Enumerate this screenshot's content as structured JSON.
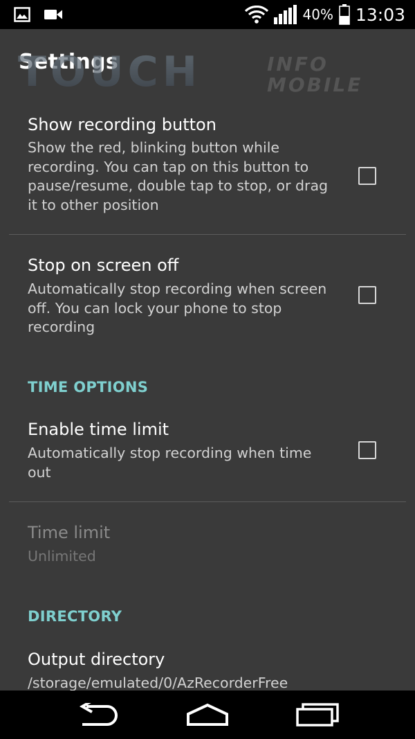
{
  "status_bar": {
    "battery_percent": "40%",
    "time": "13:03",
    "left_icons": [
      "image-notification-icon",
      "video-camera-notification-icon"
    ],
    "right_icons": [
      "wifi-icon",
      "signal-icon",
      "battery-icon"
    ]
  },
  "header": {
    "title": "Settings",
    "watermark_primary": "TOUCH",
    "watermark_secondary_top": "INFO",
    "watermark_secondary_bottom": "MOBILE"
  },
  "settings": {
    "show_recording_button": {
      "title": "Show recording button",
      "summary": "Show the red, blinking button while recording. You can tap on this button to pause/resume, double tap to stop, or drag it to other position",
      "checked": false
    },
    "stop_on_screen_off": {
      "title": "Stop on screen off",
      "summary": "Automatically stop recording when screen off. You can lock your phone to stop recording",
      "checked": false
    },
    "time_options_header": "TIME OPTIONS",
    "enable_time_limit": {
      "title": "Enable time limit",
      "summary": "Automatically stop recording when time out",
      "checked": false
    },
    "time_limit": {
      "title": "Time limit",
      "summary": "Unlimited",
      "enabled": false
    },
    "directory_header": "DIRECTORY",
    "output_directory": {
      "title": "Output directory",
      "summary": "/storage/emulated/0/AzRecorderFree"
    }
  },
  "nav_bar": {
    "icons": [
      "back-icon",
      "home-icon",
      "recent-apps-icon"
    ]
  }
}
